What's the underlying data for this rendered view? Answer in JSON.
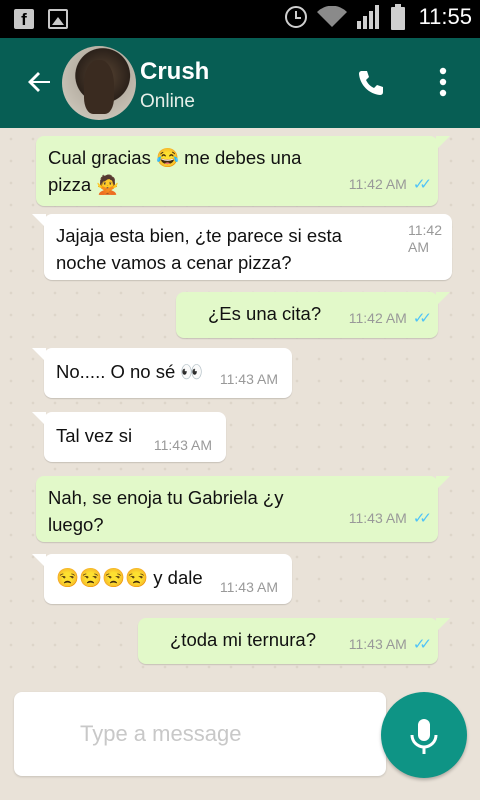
{
  "status_bar": {
    "time": "11:55"
  },
  "header": {
    "contact_name": "Crush",
    "status": "Online"
  },
  "messages": [
    {
      "direction": "out",
      "text": "Cual gracias 😂 me debes una pizza 🙅",
      "time": "11:42 AM"
    },
    {
      "direction": "in",
      "text": "Jajaja esta bien, ¿te parece si esta noche vamos a cenar pizza?",
      "time": "11:42 AM"
    },
    {
      "direction": "out",
      "text": "¿Es una cita?",
      "time": "11:42 AM"
    },
    {
      "direction": "in",
      "text": "No..... O no sé 👀",
      "time": "11:43 AM"
    },
    {
      "direction": "in",
      "text": "Tal vez si",
      "time": "11:43 AM"
    },
    {
      "direction": "out",
      "text": "Nah, se enoja tu Gabriela ¿y luego?",
      "time": "11:43 AM"
    },
    {
      "direction": "in",
      "text": "😒😒😒😒 y dale",
      "time": "11:43 AM"
    },
    {
      "direction": "out",
      "text": "¿toda mi ternura?",
      "time": "11:43 AM"
    }
  ],
  "composer": {
    "placeholder": "Type a message"
  },
  "icons": {
    "back": "arrow-left-icon",
    "call": "phone-icon",
    "menu": "more-vert-icon",
    "mic": "microphone-icon",
    "read": "double-check-icon"
  },
  "colors": {
    "header": "#075e54",
    "outgoing": "#e2f9c9",
    "incoming": "#ffffff",
    "accent": "#0e9485",
    "ticks": "#4fc3f7"
  }
}
